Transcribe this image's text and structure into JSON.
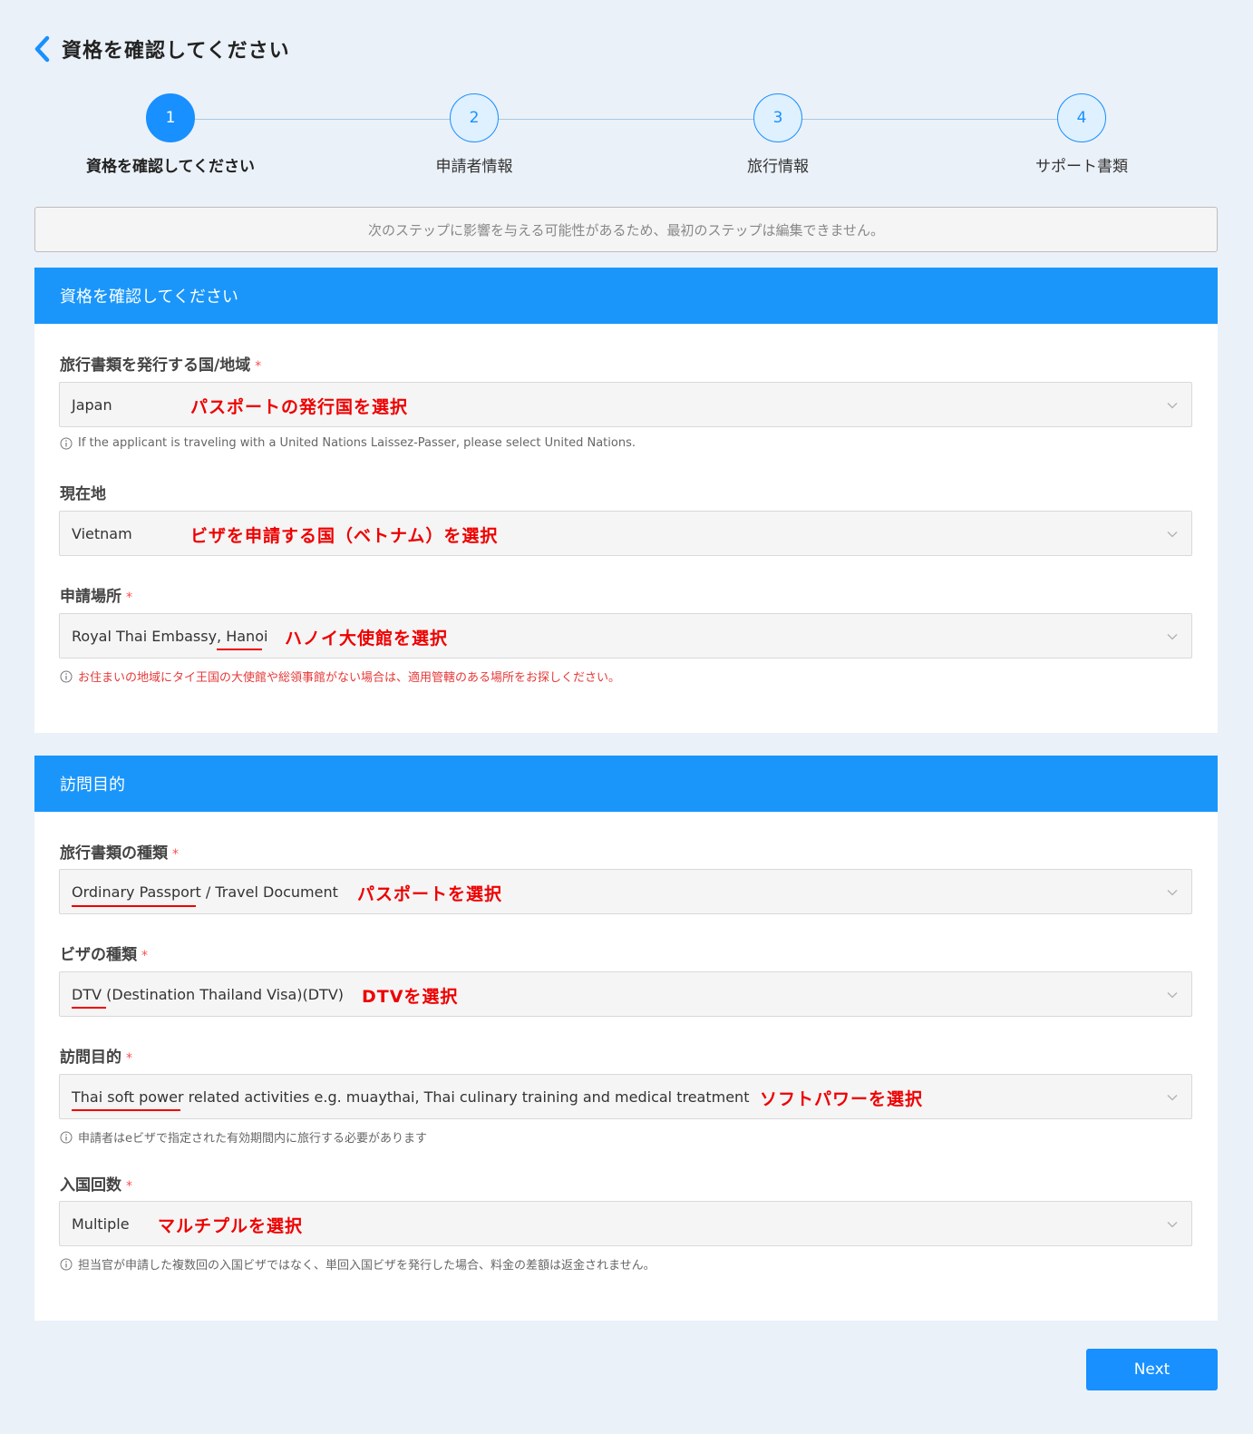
{
  "header": {
    "title": "資格を確認してください"
  },
  "steps": [
    {
      "number": "1",
      "label": "資格を確認してください",
      "state": "active"
    },
    {
      "number": "2",
      "label": "申請者情報",
      "state": "pending"
    },
    {
      "number": "3",
      "label": "旅行情報",
      "state": "pending"
    },
    {
      "number": "4",
      "label": "サポート書類",
      "state": "pending"
    }
  ],
  "notice": "次のステップに影響を与える可能性があるため、最初のステップは編集できません。",
  "section1": {
    "title": "資格を確認してください",
    "issuing_country": {
      "label": "旅行書類を発行する国/地域",
      "required": "*",
      "value": "Japan",
      "annotation": "パスポートの発行国を選択",
      "help": "If the applicant is traveling with a United Nations Laissez-Passer, please select United Nations."
    },
    "current_location": {
      "label": "現在地",
      "value": "Vietnam",
      "annotation": "ビザを申請する国（ベトナム）を選択"
    },
    "application_place": {
      "label": "申請場所",
      "required": "*",
      "value_prefix": "Royal Thai Embassy, ",
      "value_underlined": "Hanoi",
      "annotation": "ハノイ大使館を選択",
      "help": "お住まいの地域にタイ王国の大使館や総領事館がない場合は、適用管轄のある場所をお探しください。"
    }
  },
  "section2": {
    "title": "訪問目的",
    "document_type": {
      "label": "旅行書類の種類",
      "required": "*",
      "value_underlined": "Ordinary Passport",
      "value_suffix": " / Travel Document",
      "annotation": "パスポートを選択"
    },
    "visa_type": {
      "label": "ビザの種類",
      "required": "*",
      "value_underlined": "DTV",
      "value_suffix": " (Destination Thailand Visa)(DTV)",
      "annotation": "DTVを選択"
    },
    "purpose": {
      "label": "訪問目的",
      "required": "*",
      "value_underlined": "Thai soft power",
      "value_suffix": " related activities e.g. muaythai, Thai culinary training and medical treatment",
      "annotation": "ソフトパワーを選択",
      "help": "申請者はeビザで指定された有効期間内に旅行する必要があります"
    },
    "entries": {
      "label": "入国回数",
      "required": "*",
      "value": "Multiple",
      "annotation": "マルチプルを選択",
      "help": "担当官が申請した複数回の入国ビザではなく、単回入国ビザを発行した場合、料金の差額は返金されません。"
    }
  },
  "footer": {
    "next_label": "Next"
  },
  "colors": {
    "primary": "#1890ff",
    "header_bar": "#1a96fb",
    "annotation": "#ee0000",
    "required": "#ff4d4f",
    "background": "#ebf1f8"
  },
  "icons": {
    "back": "chevron-left-icon",
    "dropdown": "chevron-down-icon",
    "help": "info-circle-icon"
  }
}
